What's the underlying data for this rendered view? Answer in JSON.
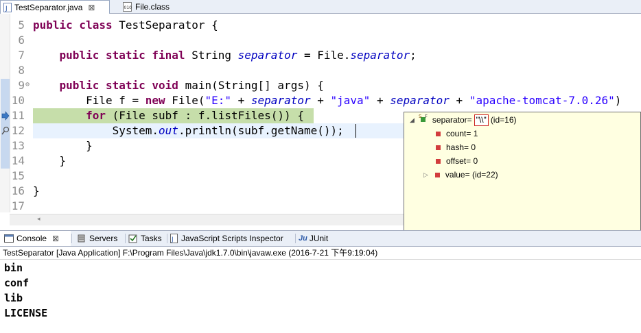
{
  "editor_tabs": [
    {
      "label": "TestSeparator.java",
      "close": "⊠",
      "active": true,
      "icon": "java-file-icon"
    },
    {
      "label": "File.class",
      "icon": "class-file-icon"
    }
  ],
  "code": {
    "lines": [
      {
        "n": "5",
        "tokens": [
          {
            "t": "public class ",
            "c": "kw"
          },
          {
            "t": "TestSeparator {",
            "c": ""
          }
        ]
      },
      {
        "n": "6",
        "tokens": []
      },
      {
        "n": "7",
        "tokens": [
          {
            "t": "    public static final ",
            "c": "kw"
          },
          {
            "t": "String ",
            "c": ""
          },
          {
            "t": "separator",
            "c": "fld"
          },
          {
            "t": " = File.",
            "c": ""
          },
          {
            "t": "separator",
            "c": "fld"
          },
          {
            "t": ";",
            "c": ""
          }
        ]
      },
      {
        "n": "8",
        "tokens": []
      },
      {
        "n": "9",
        "fold": "⊖",
        "tokens": [
          {
            "t": "    public static void ",
            "c": "kw"
          },
          {
            "t": "main(String[] args) {",
            "c": ""
          }
        ]
      },
      {
        "n": "10",
        "tokens": [
          {
            "t": "        File f = ",
            "c": ""
          },
          {
            "t": "new ",
            "c": "kw"
          },
          {
            "t": "File(",
            "c": ""
          },
          {
            "t": "\"E:\"",
            "c": "str"
          },
          {
            "t": " + ",
            "c": ""
          },
          {
            "t": "separator",
            "c": "fld"
          },
          {
            "t": " + ",
            "c": ""
          },
          {
            "t": "\"java\"",
            "c": "str"
          },
          {
            "t": " + ",
            "c": ""
          },
          {
            "t": "separator",
            "c": "fld"
          },
          {
            "t": " + ",
            "c": ""
          },
          {
            "t": "\"apache-tomcat-7.0.26\"",
            "c": "str"
          },
          {
            "t": ")",
            "c": ""
          }
        ]
      },
      {
        "n": "11",
        "tokens": [
          {
            "t": "        for ",
            "c": "kw"
          },
          {
            "t": "(File subf : f.listFiles()) {",
            "c": ""
          }
        ]
      },
      {
        "n": "12",
        "tokens": [
          {
            "t": "            System.",
            "c": ""
          },
          {
            "t": "out",
            "c": "fld"
          },
          {
            "t": ".println(subf.getName());",
            "c": ""
          }
        ]
      },
      {
        "n": "13",
        "tokens": [
          {
            "t": "        }",
            "c": ""
          }
        ]
      },
      {
        "n": "14",
        "tokens": [
          {
            "t": "    }",
            "c": ""
          }
        ]
      },
      {
        "n": "15",
        "tokens": []
      },
      {
        "n": "16",
        "tokens": [
          {
            "t": "}",
            "c": ""
          }
        ]
      },
      {
        "n": "17",
        "tokens": []
      }
    ]
  },
  "popup": {
    "root": {
      "name": "separator=",
      "value": "\"\\\\\"",
      "id": "(id=16)",
      "expand": "◢"
    },
    "fields": [
      {
        "label": "count= 1"
      },
      {
        "label": "hash= 0"
      },
      {
        "label": "offset= 0"
      },
      {
        "label": "value=  (id=22)",
        "expand": "▷"
      }
    ]
  },
  "bottom_tabs": [
    {
      "label": "Console",
      "close": "⊠",
      "active": true,
      "icon": "console-icon"
    },
    {
      "label": "Servers",
      "icon": "servers-icon"
    },
    {
      "label": "Tasks",
      "icon": "tasks-icon"
    },
    {
      "label": "JavaScript Scripts Inspector",
      "icon": "js-inspector-icon"
    },
    {
      "label": "JUnit",
      "icon": "junit-icon",
      "icon_text": "Ju"
    }
  ],
  "console": {
    "launch": "TestSeparator [Java Application] F:\\Program Files\\Java\\jdk1.7.0\\bin\\javaw.exe (2016-7-21 下午9:19:04)",
    "output": [
      "bin",
      "conf",
      "lib",
      "LICENSE"
    ]
  },
  "colors": {
    "keyword": "#7f0055",
    "field": "#0000c0",
    "string": "#2a00ff",
    "current_line": "#c6deaa"
  }
}
